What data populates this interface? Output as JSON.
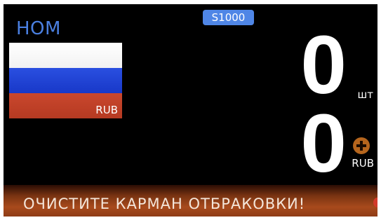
{
  "header": {
    "mode": "НОМ",
    "batch_badge": "S1000"
  },
  "flag": {
    "currency_code": "RUB",
    "stripe_colors": [
      "#ffffff",
      "#2a4fe0",
      "#c9472d"
    ]
  },
  "counter": {
    "count_value": "0",
    "count_unit": "шт",
    "amount_value": "0",
    "amount_currency": "RUB",
    "amount_icon": "plus-icon"
  },
  "status": {
    "message": "ОЧИСТИТЕ КАРМАН ОТБРАКОВКИ!"
  },
  "colors": {
    "screen_background": "#000000",
    "mode_text": "#4a7fe0",
    "badge_background": "#4f86e6",
    "message_bar": "#a84a1c",
    "plus_icon": "#b5651d"
  }
}
